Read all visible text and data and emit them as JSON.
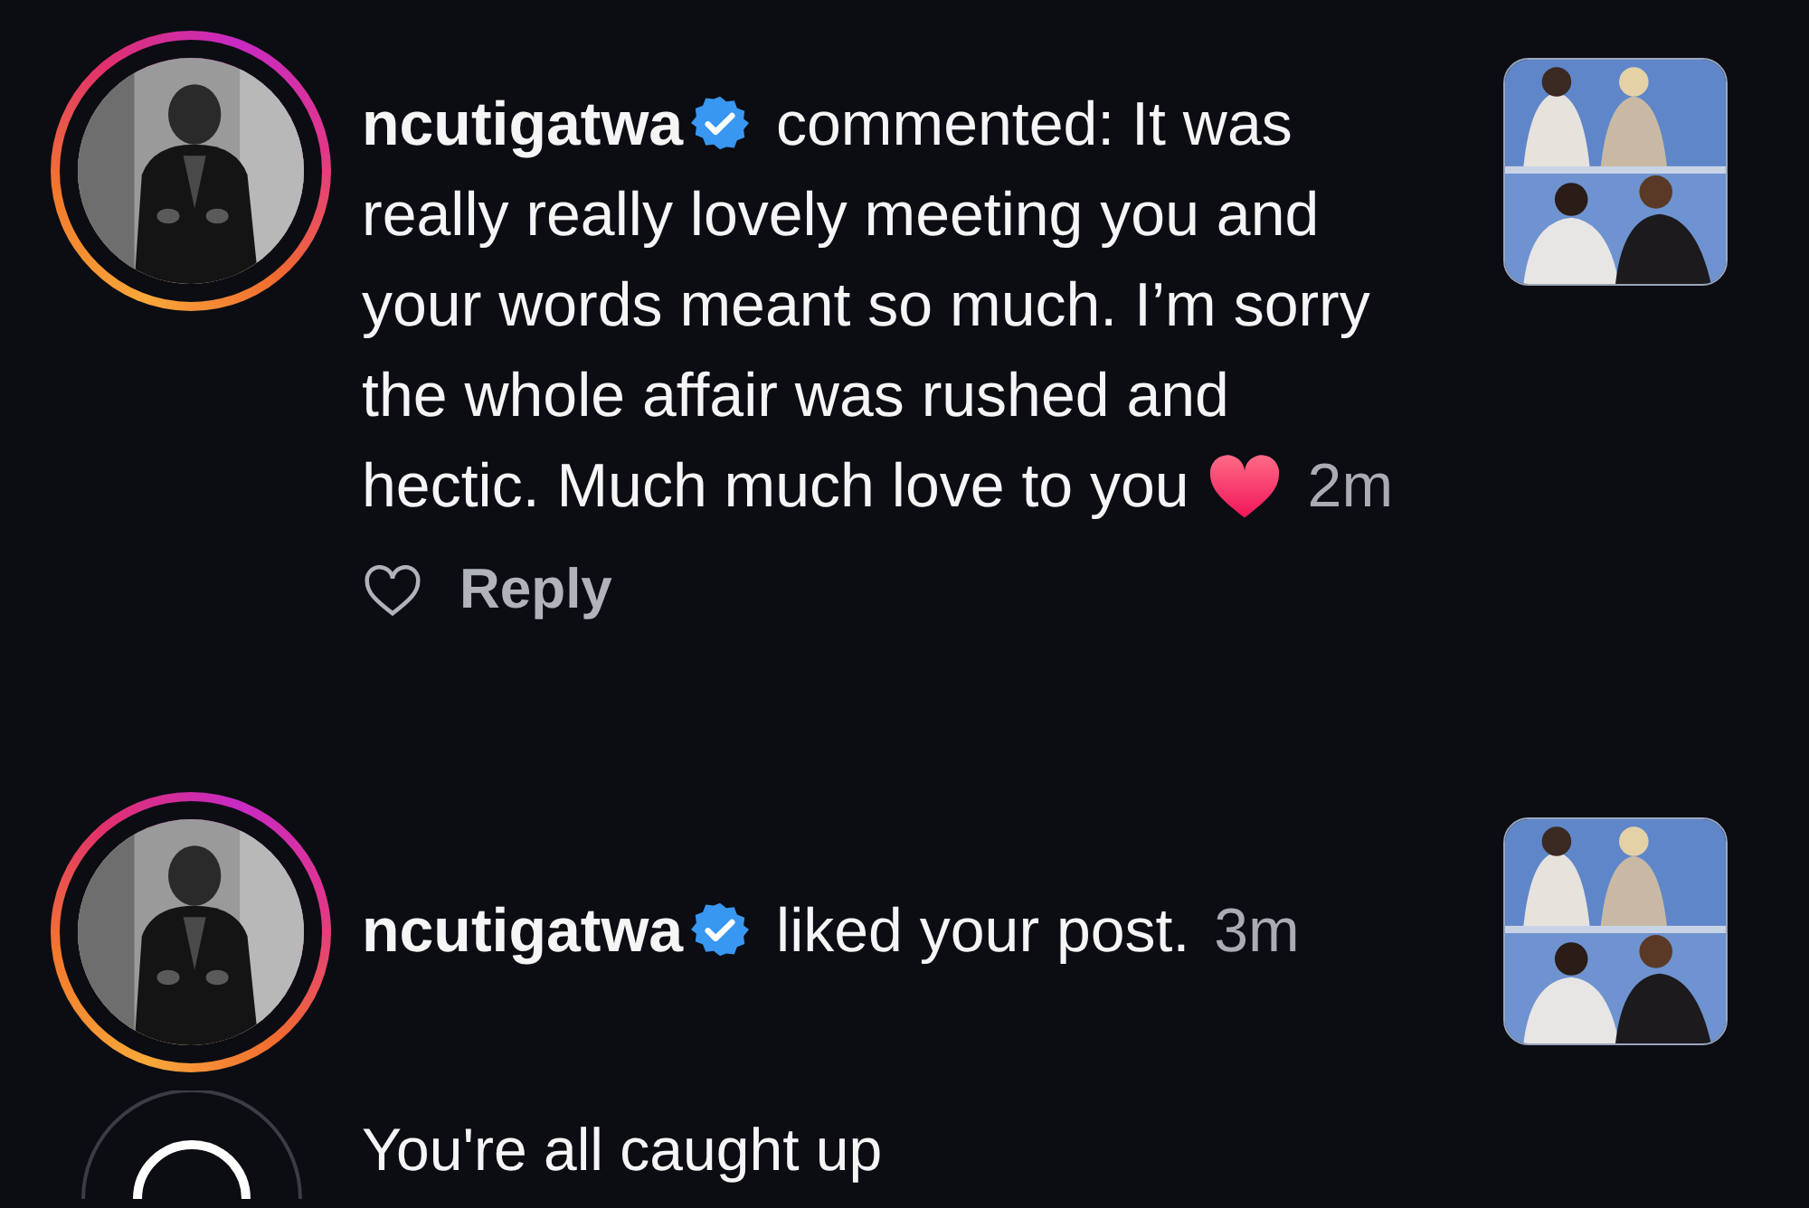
{
  "notifications": [
    {
      "kind": "comment",
      "username": "ncutigatwa",
      "verified": true,
      "story_ring": true,
      "text": "commented: It was really really lovely meeting you and your words meant so much. I’m sorry the whole affair was rushed and hectic. Much much love to you",
      "time": "2m",
      "reply_label": "Reply"
    },
    {
      "kind": "like",
      "username": "ncutigatwa",
      "verified": true,
      "story_ring": true,
      "text": "liked your post.",
      "time": "3m"
    }
  ],
  "caught_up": {
    "title": "You're all caught up"
  }
}
